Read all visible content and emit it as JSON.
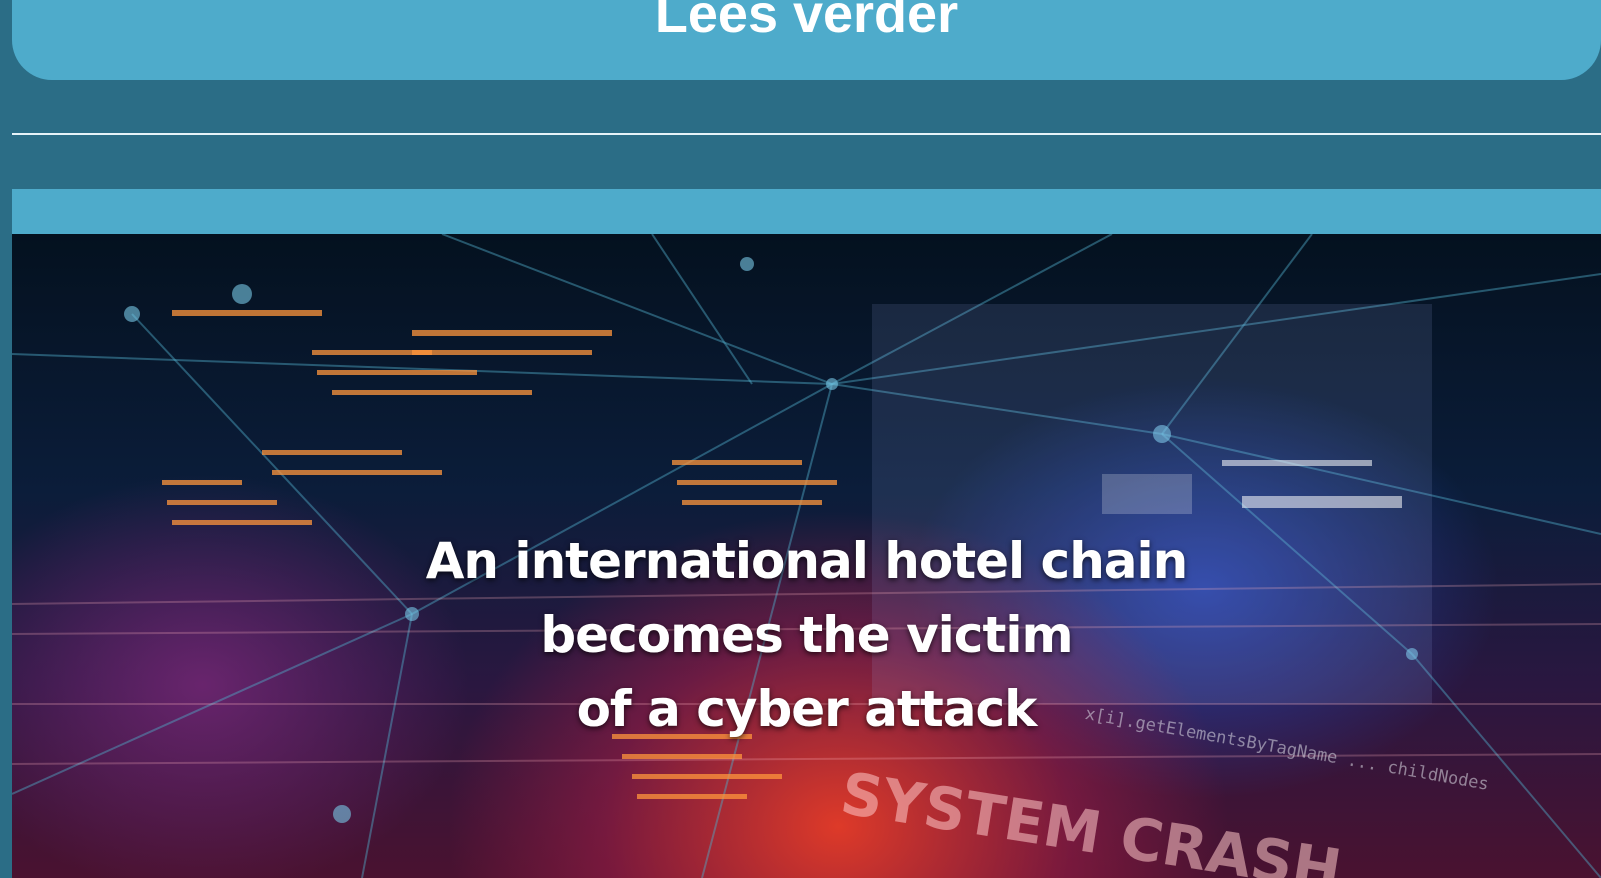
{
  "read_more": {
    "label": "Lees verder"
  },
  "article_card": {
    "image_headline": [
      "An international hotel chain",
      "becomes the victim",
      "of a cyber attack"
    ],
    "image_overlay": {
      "crash_text": "SYSTEM CRASH",
      "code_text": "x[i].getElementsByTagName ... childNodes"
    }
  },
  "colors": {
    "page_background": "#2b6d86",
    "button_background": "#4eabcb",
    "divider": "#e6f3f8",
    "headline_text": "#ffffff"
  }
}
